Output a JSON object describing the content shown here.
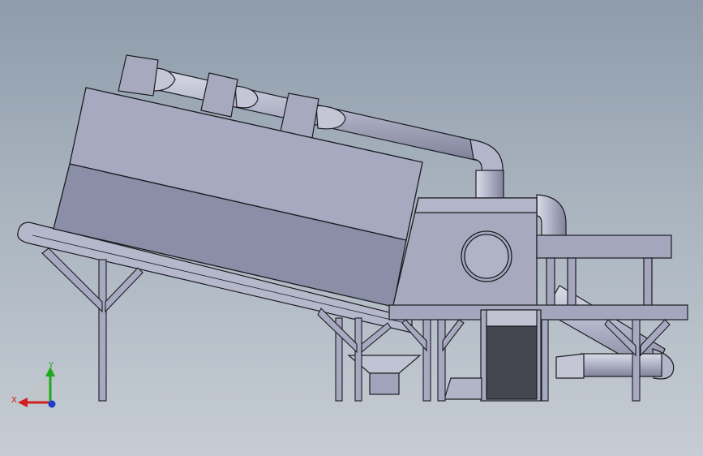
{
  "colors": {
    "background_top": "#8e9cab",
    "background_bottom": "#c6ccd3",
    "body_light": "#a6a9bf",
    "body_dark": "#8a8ea6",
    "pipe": "#a9adc2",
    "panel_dark": "#444650",
    "outline": "#1c1c22",
    "axis_x": "#d01e1e",
    "axis_y": "#1eaa1e",
    "axis_z": "#1e3cd0"
  },
  "triad": {
    "x_label": "X",
    "y_label": "Y",
    "x_color_name": "red",
    "y_color_name": "green",
    "z_color_name": "blue"
  },
  "icons": [
    "coordinate-triad-icon"
  ]
}
